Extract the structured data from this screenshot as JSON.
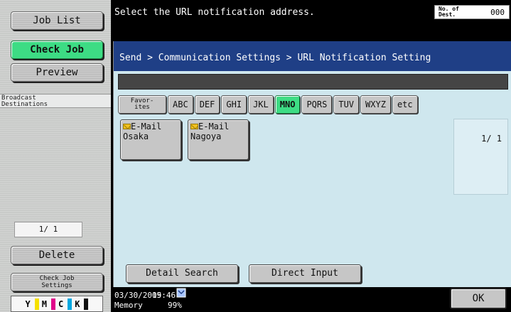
{
  "left": {
    "job_list": "Job List",
    "check_job": "Check Job",
    "preview": "Preview",
    "broadcast_line1": "Broadcast",
    "broadcast_line2": "Destinations",
    "page": "1/ 1",
    "delete": "Delete",
    "check_settings_line1": "Check Job",
    "check_settings_line2": "Settings",
    "toner": [
      "Y",
      "M",
      "C",
      "K"
    ]
  },
  "header": {
    "message": "Select the URL notification address.",
    "dest_label_line1": "No. of",
    "dest_label_line2": "Dest.",
    "dest_count": "000"
  },
  "main": {
    "breadcrumb": "Send > Communication Settings > URL Notification Setting",
    "tabs": {
      "favorites_line1": "Favor-",
      "favorites_line2": "ites",
      "abc": "ABC",
      "def": "DEF",
      "ghi": "GHI",
      "jkl": "JKL",
      "mno": "MNO",
      "pqrs": "PQRS",
      "tuv": "TUV",
      "wxyz": "WXYZ",
      "etc": "etc"
    },
    "destinations": [
      {
        "type": "E-Mail",
        "name": "Osaka"
      },
      {
        "type": "E-Mail",
        "name": "Nagoya"
      }
    ],
    "page": "1/ 1",
    "detail_search": "Detail Search",
    "direct_input": "Direct Input"
  },
  "status": {
    "date": "03/30/2009",
    "time": "15:46",
    "memory_label": "Memory",
    "memory_value": "99%",
    "ok": "OK"
  },
  "colors": {
    "active": "#3ddc84",
    "header_bar": "#1f3f86",
    "panel": "#cfe7ee",
    "toner_y": "#f5e000",
    "toner_m": "#e0008a",
    "toner_c": "#00a7e0",
    "toner_k": "#111111"
  }
}
